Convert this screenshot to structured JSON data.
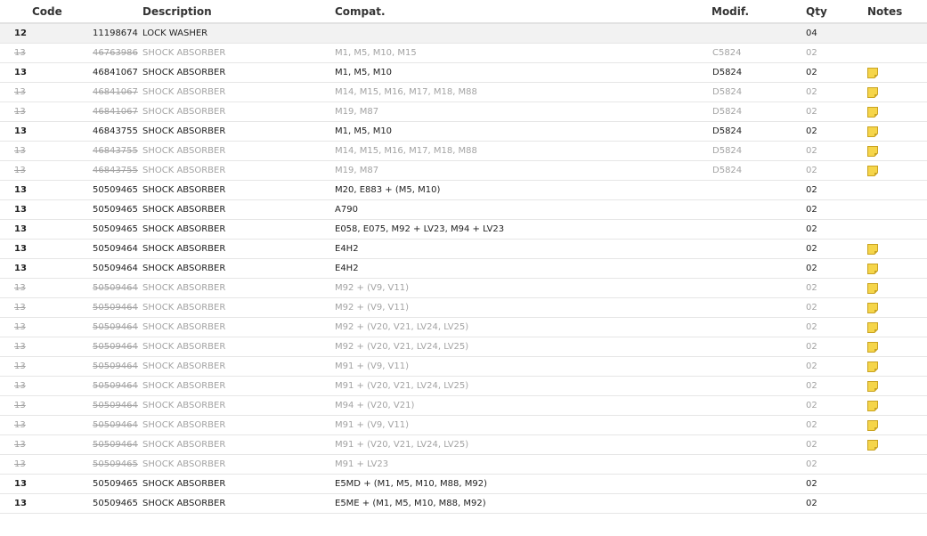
{
  "headers": {
    "code": "Code",
    "description": "Description",
    "compat": "Compat.",
    "modif": "Modif.",
    "qty": "Qty",
    "notes": "Notes"
  },
  "colors": {
    "note_fill": "#f5d54a",
    "note_border": "#c9a321",
    "muted_text": "#a3a3a3",
    "active_text": "#222222"
  },
  "rows": [
    {
      "pos": "12",
      "code": "11198674",
      "desc": "LOCK WASHER",
      "compat": "",
      "modif": "",
      "qty": "04",
      "note": false,
      "old": false,
      "grey": true
    },
    {
      "pos": "13",
      "code": "46763986",
      "desc": "SHOCK ABSORBER",
      "compat": "M1, M5, M10, M15",
      "modif": "C5824",
      "qty": "02",
      "note": false,
      "old": true,
      "grey": false
    },
    {
      "pos": "13",
      "code": "46841067",
      "desc": "SHOCK ABSORBER",
      "compat": "M1, M5, M10",
      "modif": "D5824",
      "qty": "02",
      "note": true,
      "old": false,
      "grey": false
    },
    {
      "pos": "13",
      "code": "46841067",
      "desc": "SHOCK ABSORBER",
      "compat": "M14, M15, M16, M17, M18, M88",
      "modif": "D5824",
      "qty": "02",
      "note": true,
      "old": true,
      "grey": false
    },
    {
      "pos": "13",
      "code": "46841067",
      "desc": "SHOCK ABSORBER",
      "compat": "M19, M87",
      "modif": "D5824",
      "qty": "02",
      "note": true,
      "old": true,
      "grey": false
    },
    {
      "pos": "13",
      "code": "46843755",
      "desc": "SHOCK ABSORBER",
      "compat": "M1, M5, M10",
      "modif": "D5824",
      "qty": "02",
      "note": true,
      "old": false,
      "grey": false
    },
    {
      "pos": "13",
      "code": "46843755",
      "desc": "SHOCK ABSORBER",
      "compat": "M14, M15, M16, M17, M18, M88",
      "modif": "D5824",
      "qty": "02",
      "note": true,
      "old": true,
      "grey": false
    },
    {
      "pos": "13",
      "code": "46843755",
      "desc": "SHOCK ABSORBER",
      "compat": "M19, M87",
      "modif": "D5824",
      "qty": "02",
      "note": true,
      "old": true,
      "grey": false
    },
    {
      "pos": "13",
      "code": "50509465",
      "desc": "SHOCK ABSORBER",
      "compat": "M20, E883 + (M5, M10)",
      "modif": "",
      "qty": "02",
      "note": false,
      "old": false,
      "grey": false
    },
    {
      "pos": "13",
      "code": "50509465",
      "desc": "SHOCK ABSORBER",
      "compat": "A790",
      "modif": "",
      "qty": "02",
      "note": false,
      "old": false,
      "grey": false
    },
    {
      "pos": "13",
      "code": "50509465",
      "desc": "SHOCK ABSORBER",
      "compat": "E058, E075, M92 + LV23, M94 + LV23",
      "modif": "",
      "qty": "02",
      "note": false,
      "old": false,
      "grey": false
    },
    {
      "pos": "13",
      "code": "50509464",
      "desc": "SHOCK ABSORBER",
      "compat": "E4H2",
      "modif": "",
      "qty": "02",
      "note": true,
      "old": false,
      "grey": false
    },
    {
      "pos": "13",
      "code": "50509464",
      "desc": "SHOCK ABSORBER",
      "compat": "E4H2",
      "modif": "",
      "qty": "02",
      "note": true,
      "old": false,
      "grey": false
    },
    {
      "pos": "13",
      "code": "50509464",
      "desc": "SHOCK ABSORBER",
      "compat": "M92 + (V9, V11)",
      "modif": "",
      "qty": "02",
      "note": true,
      "old": true,
      "grey": false
    },
    {
      "pos": "13",
      "code": "50509464",
      "desc": "SHOCK ABSORBER",
      "compat": "M92 + (V9, V11)",
      "modif": "",
      "qty": "02",
      "note": true,
      "old": true,
      "grey": false
    },
    {
      "pos": "13",
      "code": "50509464",
      "desc": "SHOCK ABSORBER",
      "compat": "M92 + (V20, V21, LV24, LV25)",
      "modif": "",
      "qty": "02",
      "note": true,
      "old": true,
      "grey": false
    },
    {
      "pos": "13",
      "code": "50509464",
      "desc": "SHOCK ABSORBER",
      "compat": "M92 + (V20, V21, LV24, LV25)",
      "modif": "",
      "qty": "02",
      "note": true,
      "old": true,
      "grey": false
    },
    {
      "pos": "13",
      "code": "50509464",
      "desc": "SHOCK ABSORBER",
      "compat": "M91 + (V9, V11)",
      "modif": "",
      "qty": "02",
      "note": true,
      "old": true,
      "grey": false
    },
    {
      "pos": "13",
      "code": "50509464",
      "desc": "SHOCK ABSORBER",
      "compat": "M91 + (V20, V21, LV24, LV25)",
      "modif": "",
      "qty": "02",
      "note": true,
      "old": true,
      "grey": false
    },
    {
      "pos": "13",
      "code": "50509464",
      "desc": "SHOCK ABSORBER",
      "compat": "M94 + (V20, V21)",
      "modif": "",
      "qty": "02",
      "note": true,
      "old": true,
      "grey": false
    },
    {
      "pos": "13",
      "code": "50509464",
      "desc": "SHOCK ABSORBER",
      "compat": "M91 + (V9, V11)",
      "modif": "",
      "qty": "02",
      "note": true,
      "old": true,
      "grey": false
    },
    {
      "pos": "13",
      "code": "50509464",
      "desc": "SHOCK ABSORBER",
      "compat": "M91 + (V20, V21, LV24, LV25)",
      "modif": "",
      "qty": "02",
      "note": true,
      "old": true,
      "grey": false
    },
    {
      "pos": "13",
      "code": "50509465",
      "desc": "SHOCK ABSORBER",
      "compat": "M91 + LV23",
      "modif": "",
      "qty": "02",
      "note": false,
      "old": true,
      "grey": false
    },
    {
      "pos": "13",
      "code": "50509465",
      "desc": "SHOCK ABSORBER",
      "compat": "E5MD + (M1, M5, M10, M88, M92)",
      "modif": "",
      "qty": "02",
      "note": false,
      "old": false,
      "grey": false
    },
    {
      "pos": "13",
      "code": "50509465",
      "desc": "SHOCK ABSORBER",
      "compat": "E5ME + (M1, M5, M10, M88, M92)",
      "modif": "",
      "qty": "02",
      "note": false,
      "old": false,
      "grey": false
    }
  ]
}
